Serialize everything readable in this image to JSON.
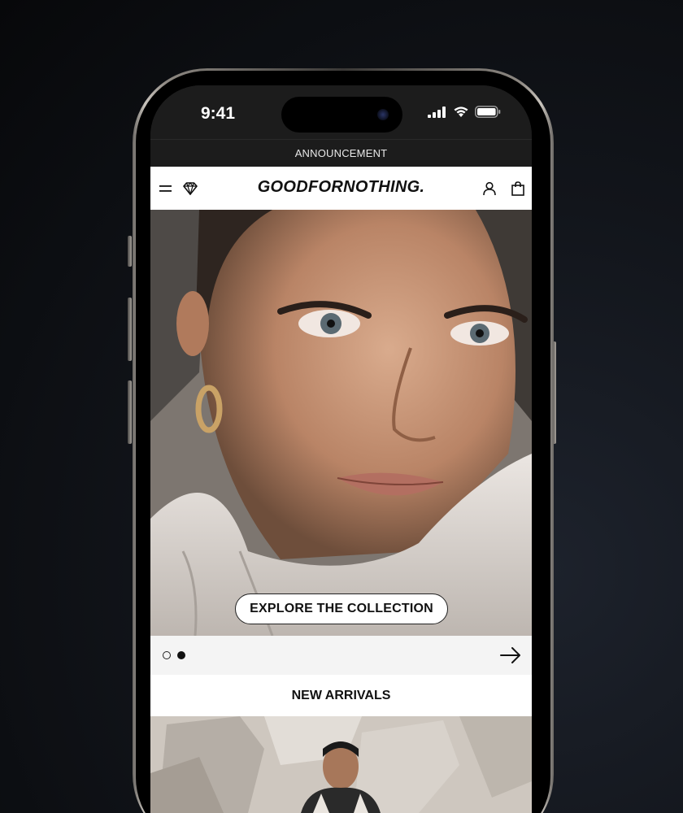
{
  "status_bar": {
    "time": "9:41",
    "icons": [
      "signal-icon",
      "wifi-icon",
      "battery-icon"
    ]
  },
  "announcement": {
    "text": "ANNOUNCEMENT"
  },
  "header": {
    "logo": "GOODFORNOTHING.",
    "left_icons": [
      "menu-icon",
      "diamond-icon"
    ],
    "right_icons": [
      "account-icon",
      "bag-icon"
    ]
  },
  "hero": {
    "cta_label": "EXPLORE THE COLLECTION",
    "carousel": {
      "total_slides": 2,
      "active_slide": 2
    }
  },
  "new_arrivals": {
    "title": "NEW ARRIVALS"
  },
  "colors": {
    "background": "#0b0d11",
    "status_bar": "#1c1c1c",
    "header": "#ffffff",
    "text_primary": "#111111"
  }
}
